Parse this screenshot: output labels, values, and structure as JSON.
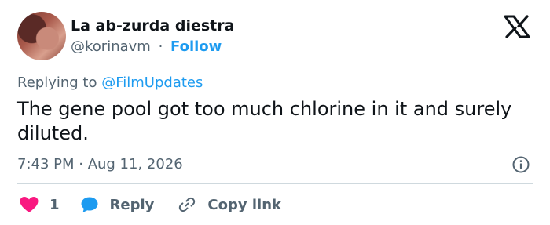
{
  "author": {
    "display_name": "La ab-zurda diestra",
    "handle": "@korinavm",
    "separator": "·",
    "follow_label": "Follow"
  },
  "reply_context": {
    "prefix": "Replying to",
    "mention": "@FilmUpdates"
  },
  "tweet": {
    "text": "The gene pool got too much chlorine in it and surely diluted.",
    "timestamp": "7:43 PM · Aug 11, 2026"
  },
  "actions": {
    "like_count": "1",
    "reply_label": "Reply",
    "copy_link_label": "Copy link"
  },
  "icons": {
    "brand": "x-logo-icon",
    "info": "info-icon",
    "like": "heart-icon",
    "reply": "speech-bubble-icon",
    "copy_link": "link-icon"
  },
  "colors": {
    "text": "#0f1419",
    "secondary": "#536471",
    "accent": "#1d9bf0",
    "like": "#f91880",
    "divider": "#cfd9de"
  }
}
